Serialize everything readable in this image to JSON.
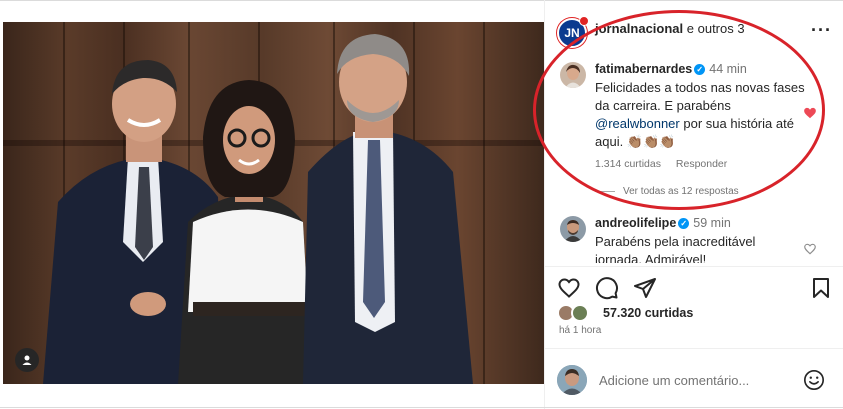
{
  "header": {
    "account": "jornalnacional",
    "suffix": "e outros 3",
    "avatar_text": "JN"
  },
  "comments": [
    {
      "user": "fatimabernardes",
      "verified": true,
      "time": "44 min",
      "text_before": "Felicidades a todos nas novas fases da carreira. E parabéns",
      "mention": "@realwbonner",
      "text_after": "por sua história até aqui. 👏🏽👏🏽👏🏽",
      "likes": "1.314 curtidas",
      "reply_label": "Responder",
      "view_replies": "Ver todas as 12 respostas",
      "liked": true
    },
    {
      "user": "andreolifelipe",
      "verified": true,
      "time": "59 min",
      "text": "Parabéns pela inacreditável jornada. Admirável!",
      "liked": false
    }
  ],
  "post": {
    "likes": "57.320 curtidas",
    "time_ago": "há 1 hora"
  },
  "comment_box": {
    "placeholder": "Adicione um comentário..."
  },
  "icons": {
    "like": "heart-outline-icon",
    "comment": "comment-bubble-icon",
    "share": "paper-plane-icon",
    "save": "bookmark-icon",
    "emoji": "smiley-icon",
    "tag": "person-tag-icon",
    "more": "more-options-icon"
  },
  "colors": {
    "liked_heart": "#ed4956",
    "verified": "#0095f6",
    "annotation": "#d8232a",
    "mention": "#00376b"
  }
}
